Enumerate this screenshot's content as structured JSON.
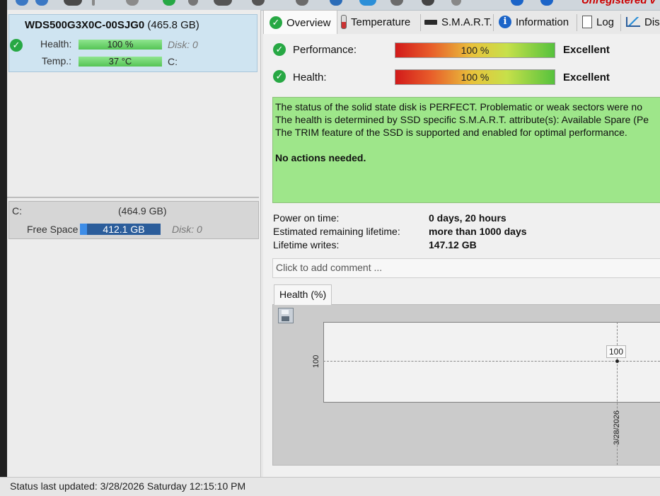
{
  "app": {
    "unregistered_label": "Unregistered v"
  },
  "disk": {
    "model": "WDS500G3X0C-00SJG0",
    "size": "(465.8 GB)",
    "health_label": "Health:",
    "health_value": "100 %",
    "health_disk": "Disk: 0",
    "temp_label": "Temp.:",
    "temp_value": "37 °C",
    "temp_drive": "C:"
  },
  "partition": {
    "letter": "C:",
    "size": "(464.9 GB)",
    "free_label": "Free Space",
    "free_value": "412.1 GB",
    "free_fraction": 0.886,
    "disk": "Disk: 0"
  },
  "tabs": [
    {
      "label": "Overview",
      "icon": "check-icon"
    },
    {
      "label": "Temperature",
      "icon": "thermometer-icon"
    },
    {
      "label": "S.M.A.R.T.",
      "icon": "ssd-icon"
    },
    {
      "label": "Information",
      "icon": "info-icon"
    },
    {
      "label": "Log",
      "icon": "document-icon"
    },
    {
      "label": "Dis",
      "icon": "chart-icon"
    }
  ],
  "overview": {
    "performance_label": "Performance:",
    "performance_value": "100 %",
    "performance_rating": "Excellent",
    "health_label": "Health:",
    "health_value": "100 %",
    "health_rating": "Excellent",
    "message_lines": [
      "The status of the solid state disk is PERFECT. Problematic or weak sectors were no",
      "The health is determined by SSD specific S.M.A.R.T. attribute(s):  Available Spare (Pe",
      "The TRIM feature of the SSD is supported and enabled for optimal performance."
    ],
    "message_action": "No actions needed.",
    "power_on_label": "Power on time:",
    "power_on_value": "0 days, 20 hours",
    "lifetime_label": "Estimated remaining lifetime:",
    "lifetime_value": "more than 1000 days",
    "writes_label": "Lifetime writes:",
    "writes_value": "147.12 GB",
    "comment_placeholder": "Click to add comment ..."
  },
  "chart_tab_label": "Health (%)",
  "chart_data": {
    "type": "line",
    "title": "Health (%)",
    "x": [
      "3/28/2026"
    ],
    "y": [
      100
    ],
    "y_ticks": [
      "100"
    ],
    "point_labels": [
      "100"
    ],
    "grid": true
  },
  "status": {
    "text": "Status last updated: 3/28/2026 Saturday 12:15:10 PM"
  },
  "colors": {
    "accent_blue": "#cfe4f1",
    "ok_green": "#27a844",
    "message_green": "#9ee68a",
    "free_space_blue": "#2b5d9b"
  }
}
